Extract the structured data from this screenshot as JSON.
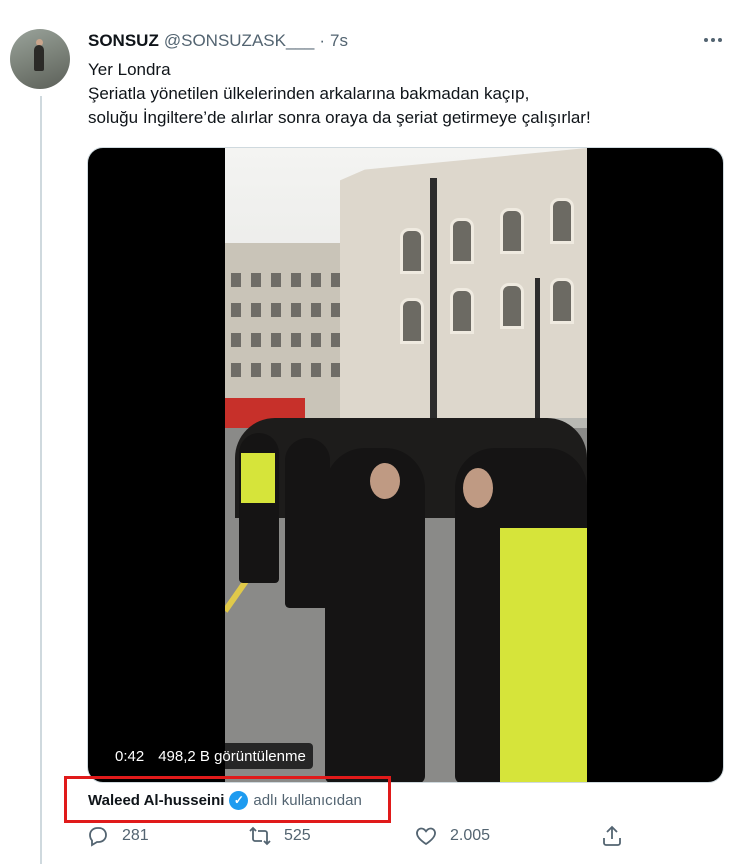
{
  "tweet": {
    "display_name": "SONSUZ",
    "handle": "@SONSUZASK___",
    "separator": "·",
    "time": "7s",
    "text_lines": [
      "Yer Londra",
      "Şeriatla yönetilen ülkelerinden arkalarına bakmadan kaçıp,",
      "soluğu İngiltere’de alırlar sonra oraya da şeriat getirmeye çalışırlar!"
    ]
  },
  "video": {
    "duration": "0:42",
    "views": "498,2 B görüntülenme"
  },
  "attribution": {
    "name": "Waleed Al-husseini",
    "verified_icon": "✓",
    "suffix": "adlı kullanıcıdan"
  },
  "actions": {
    "reply_count": "281",
    "retweet_count": "525",
    "like_count": "2.005"
  },
  "icons": {
    "reply": "reply-icon",
    "retweet": "retweet-icon",
    "like": "heart-icon",
    "share": "share-icon",
    "more": "more-icon",
    "verified": "verified-badge-icon"
  },
  "colors": {
    "text_primary": "#0f1419",
    "text_secondary": "#536471",
    "verified_blue": "#1d9bf0",
    "highlight_red": "#e01a1a"
  }
}
